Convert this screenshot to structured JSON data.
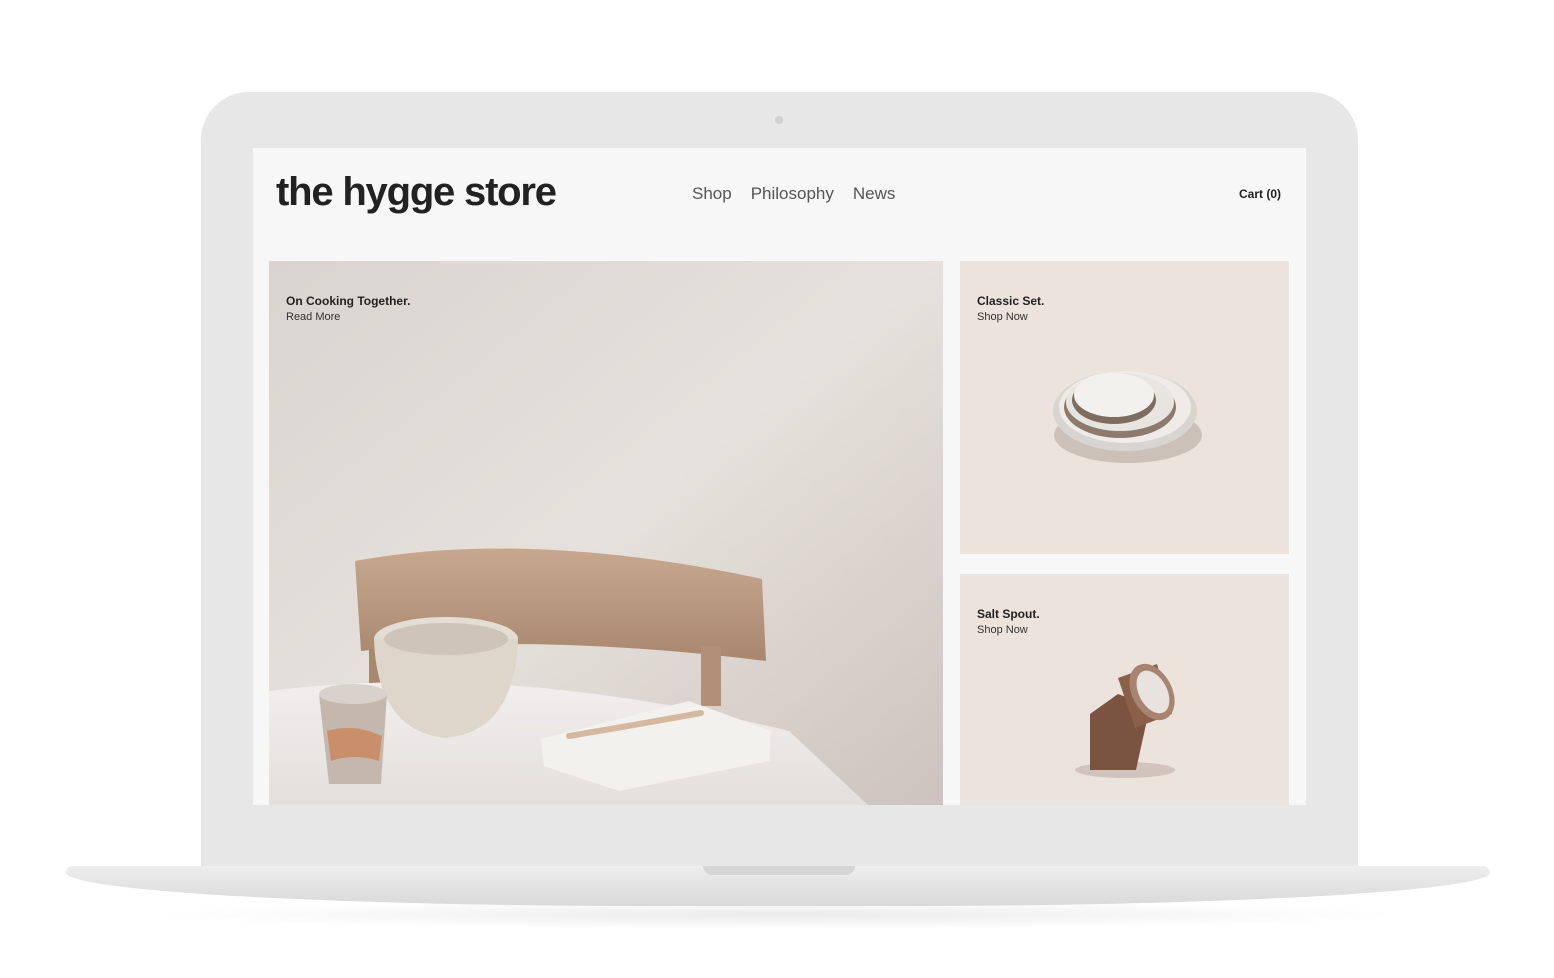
{
  "site": {
    "logo": "the hygge store"
  },
  "nav": {
    "items": [
      {
        "label": "Shop"
      },
      {
        "label": "Philosophy"
      },
      {
        "label": "News"
      }
    ],
    "cart_label": "Cart (0)"
  },
  "hero": {
    "title": "On Cooking Together.",
    "link": "Read More"
  },
  "products": [
    {
      "title": "Classic Set.",
      "link": "Shop Now"
    },
    {
      "title": "Salt Spout.",
      "link": "Shop Now"
    }
  ],
  "colors": {
    "screen_bg": "#f7f7f7",
    "product_bg": "#ece3dc",
    "text": "#222222",
    "nav_text": "#555555",
    "laptop_frame": "#e7e7e7"
  }
}
